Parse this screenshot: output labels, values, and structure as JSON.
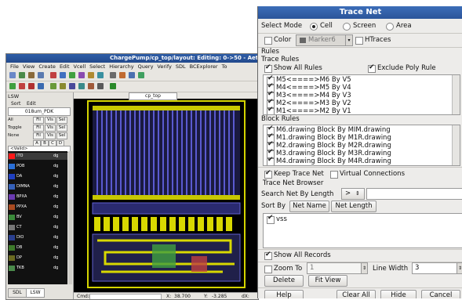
{
  "layout_window": {
    "title": "ChargePump/cp_top/layout: Editing: 0->50 - Aeth",
    "menus": [
      "File",
      "View",
      "Create",
      "Edit",
      "Vcell",
      "Select",
      "Hierarchy",
      "Query",
      "Verify",
      "SDL",
      "BCExplorer",
      "To"
    ],
    "lsw": {
      "title": "LSW",
      "sort_label": "Sort",
      "edit_label": "Edit",
      "pdk": "018um_PDK",
      "rows": [
        {
          "label": "All",
          "buttons": [
            "Fil",
            "Vis",
            "Sel"
          ]
        },
        {
          "label": "Toggle",
          "buttons": [
            "Fil",
            "Vis",
            "Sel"
          ]
        },
        {
          "label": "None",
          "buttons": [
            "Fil",
            "Vis",
            "Sel"
          ]
        }
      ],
      "abcd": [
        "A",
        "B",
        "C",
        "D"
      ],
      "valid_select": "<Valid>",
      "layers": [
        {
          "name": "ITO",
          "purpose": "dg",
          "color": "#ff1a1a"
        },
        {
          "name": "POB",
          "purpose": "dg",
          "color": "#2a6fd6"
        },
        {
          "name": "DA",
          "purpose": "dg",
          "color": "#1f3fbf"
        },
        {
          "name": "DIMNA",
          "purpose": "dg",
          "color": "#3560b8"
        },
        {
          "name": "BPXA",
          "purpose": "dg",
          "color": "#6a3ab0"
        },
        {
          "name": "PPXA",
          "purpose": "dg",
          "color": "#a84a20"
        },
        {
          "name": "BV",
          "purpose": "dg",
          "color": "#3a8a3a"
        },
        {
          "name": "CT",
          "purpose": "dg",
          "color": "#777777"
        },
        {
          "name": "DIO",
          "purpose": "dg",
          "color": "#2a3f8f"
        },
        {
          "name": "DB",
          "purpose": "dg",
          "color": "#3d7a2a"
        },
        {
          "name": "DP",
          "purpose": "dg",
          "color": "#6a6a20"
        },
        {
          "name": "TKB",
          "purpose": "dg",
          "color": "#4a8a4a"
        }
      ],
      "tabs": [
        "SDL",
        "LSW"
      ]
    },
    "canvas_tab": "cp_top",
    "status": {
      "cmd_label": "Cmd>",
      "x_label": "X:",
      "x_value": "38.700",
      "y_label": "Y:",
      "y_value": "-3.285",
      "dx_label": "dX:"
    }
  },
  "trace_dialog": {
    "title": "Trace Net",
    "select_mode_label": "Select Mode",
    "modes": [
      {
        "label": "Cell",
        "selected": true
      },
      {
        "label": "Screen",
        "selected": false
      },
      {
        "label": "Area",
        "selected": false
      }
    ],
    "color_label": "Color",
    "marker_value": "Marker6",
    "htraces_label": "HTraces",
    "rules_label": "Rules",
    "trace_rules_label": "Trace Rules",
    "show_all_rules_label": "Show All Rules",
    "exclude_poly_label": "Exclude Poly Rule",
    "trace_rules": [
      "M5<====>M6 By V5",
      "M4<====>M5 By V4",
      "M3<====>M4 By V3",
      "M2<====>M3 By V2",
      "M1<====>M2 By V1"
    ],
    "block_rules_label": "Block Rules",
    "block_rules": [
      "M6.drawing Block By MIM.drawing",
      "M1.drawing Block By M1R.drawing",
      "M2.drawing Block By M2R.drawing",
      "M3.drawing Block By M3R.drawing",
      "M4.drawing Block By M4R.drawing"
    ],
    "keep_trace_label": "Keep Trace Net",
    "virtual_conn_label": "Virtual Connections",
    "browser_label": "Trace Net Browser",
    "search_label": "Search Net By Length",
    "search_op": ">",
    "sort_by_label": "Sort By",
    "net_name_button": "Net Name",
    "net_length_button": "Net Length",
    "nets": [
      "vss"
    ],
    "show_all_records_label": "Show All Records",
    "zoom_to_label": "Zoom To",
    "zoom_value": "1",
    "line_width_label": "Line Width",
    "line_width_value": "3",
    "delete_button": "Delete",
    "fit_view_button": "Fit View",
    "help_button": "Help",
    "clear_all_button": "Clear All",
    "hide_button": "Hide",
    "cancel_button": "Cancel"
  }
}
